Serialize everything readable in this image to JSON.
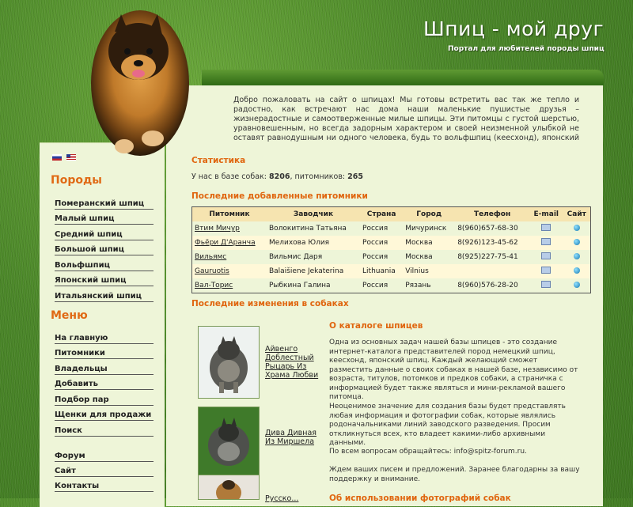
{
  "header": {
    "title": "Шпиц - мой друг",
    "subtitle": "Портал для любителей породы шпиц"
  },
  "welcome_text": "Добро пожаловать на сайт о шпицах! Мы готовы встретить вас так же тепло и радостно, как встречают нас дома наши маленькие пушистые друзья – жизнерадостные и самоотверженные милые шпицы. Эти питомцы с густой шерстью, уравновешенным, но всегда задорным характером и своей неизменной улыбкой не оставят равнодушным ни одного человека, будь то вольфшпиц (кеесхонд), японский шпиц, немецкий или померанский шпиц, по-другому померанец.",
  "sidebar": {
    "breeds_heading": "Породы",
    "breeds": [
      "Померанский шпиц",
      "Малый шпиц",
      "Средний шпиц",
      "Большой шпиц",
      "Вольфшпиц",
      "Японский шпиц",
      "Итальянский шпиц"
    ],
    "menu_heading": "Меню",
    "menu": [
      "На главную",
      "Питомники",
      "Владельцы",
      "Добавить",
      "Подбор пар",
      "Щенки для продажи",
      "Поиск"
    ],
    "extra": [
      "Форум",
      "Сайт",
      "Контакты"
    ]
  },
  "stats": {
    "title": "Статистика",
    "prefix": "У нас в базе собак:",
    "dogs": "8206",
    "mid": ", питомников:",
    "kennels": "265"
  },
  "kennels_section": {
    "title": "Последние добавленные питомники",
    "headers": [
      "Питомник",
      "Заводчик",
      "Страна",
      "Город",
      "Телефон",
      "E-mail",
      "Сайт"
    ],
    "rows": [
      {
        "kennel": "Втим Мичур",
        "breeder": "Волокитина Татьяна",
        "country": "Россия",
        "city": "Мичуринск",
        "phone": "8(960)657-68-30",
        "email": true,
        "site": true
      },
      {
        "kennel": "Фьёри Д'Аранча",
        "breeder": "Мелихова Юлия",
        "country": "Россия",
        "city": "Москва",
        "phone": "8(926)123-45-62",
        "email": true,
        "site": true
      },
      {
        "kennel": "Вильямс",
        "breeder": "Вильмис Даря",
        "country": "Россия",
        "city": "Москва",
        "phone": "8(925)227-75-41",
        "email": true,
        "site": true
      },
      {
        "kennel": "Gauruotis",
        "breeder": "Balaišiene Jekaterina",
        "country": "Lithuania",
        "city": "Vilnius",
        "phone": "",
        "email": true,
        "site": true
      },
      {
        "kennel": "Вал-Торис",
        "breeder": "Рыбкина Галина",
        "country": "Россия",
        "city": "Рязань",
        "phone": "8(960)576-28-20",
        "email": true,
        "site": true
      }
    ]
  },
  "dogs_section": {
    "title": "Последние изменения в собаках",
    "dogs": [
      {
        "name": "Айвенго Доблестный Рыцарь Из Храма Любви"
      },
      {
        "name": "Дива Дивная Из Миршела"
      },
      {
        "name": "Русско..."
      }
    ]
  },
  "about": {
    "title": "О каталоге шпицев",
    "p1": "Одна из основных задач нашей базы шпицев - это создание интернет-каталога представителей пород немецкий шпиц, кеесхонд, японский шпиц. Каждый желающий сможет разместить данные о своих собаках в нашей базе, независимо от возраста, титулов, потомков и предков собаки, а страничка с информацией будет также являться и мини-рекламой вашего питомца.",
    "p2": "Неоценимое значение для создания базы будет представлять любая информация и фотографии собак, которые являлись родоначальниками линий заводского разведения. Просим откликнуться всех, кто владеет какими-либо архивными данными.",
    "p3": "По всем вопросам обращайтесь: info@spitz-forum.ru.",
    "p4": "Ждем ваших писем и предложений. Заранее благодарны за вашу поддержку и внимание.",
    "p5": "Об использовании фотографий собак"
  }
}
